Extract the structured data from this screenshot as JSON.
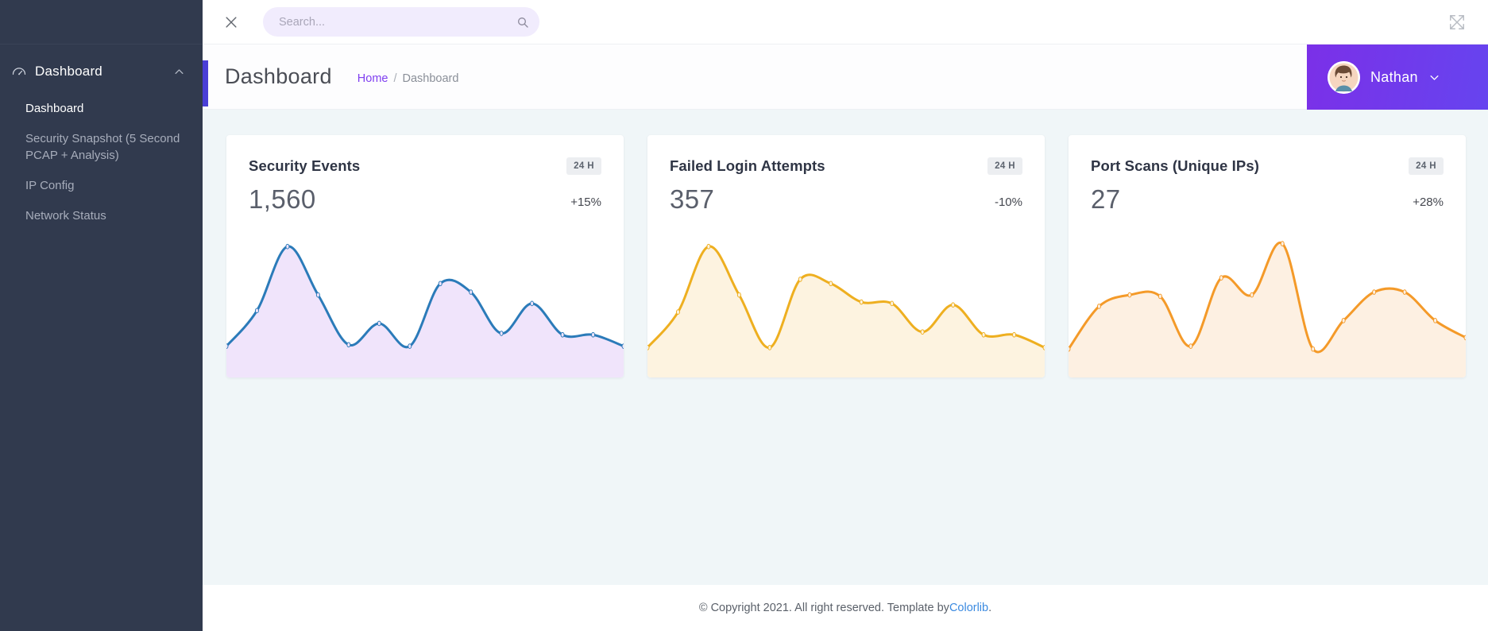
{
  "sidebar": {
    "group": {
      "label": "Dashboard",
      "icon": "speedometer-icon",
      "chevron": "chevron-up-icon"
    },
    "items": [
      {
        "label": "Dashboard",
        "active": true
      },
      {
        "label": "Security Snapshot (5 Second PCAP + Analysis)",
        "active": false
      },
      {
        "label": "IP Config",
        "active": false
      },
      {
        "label": "Network Status",
        "active": false
      }
    ]
  },
  "topbar": {
    "close_icon": "close-icon",
    "search": {
      "value": "",
      "placeholder": "Search...",
      "icon": "search-icon"
    },
    "fullscreen_icon": "fullscreen-expand-icon"
  },
  "header": {
    "title": "Dashboard",
    "breadcrumb": {
      "home": "Home",
      "separator": "/",
      "current": "Dashboard"
    },
    "profile": {
      "name": "Nathan",
      "caret_icon": "chevron-down-icon",
      "avatar_icon": "user-avatar"
    },
    "accent_color": "#4a3fd6",
    "profile_gradient_from": "#7b30e8",
    "profile_gradient_to": "#6644ef"
  },
  "cards": [
    {
      "title": "Security Events",
      "badge": "24 H",
      "value": "1,560",
      "delta": "+15%",
      "line_color": "#2b7bb9",
      "fill_color": "#f0e4fb"
    },
    {
      "title": "Failed Login Attempts",
      "badge": "24 H",
      "value": "357",
      "delta": "-10%",
      "line_color": "#eeaf20",
      "fill_color": "#fdf3e0"
    },
    {
      "title": "Port Scans (Unique IPs)",
      "badge": "24 H",
      "value": "27",
      "delta": "+28%",
      "line_color": "#f49a29",
      "fill_color": "#fdf0e2"
    }
  ],
  "chart_data": [
    {
      "type": "area",
      "title": "Security Events",
      "xlabel": "",
      "ylabel": "",
      "grid": false,
      "legend": "none",
      "line_color": "#2b7bb9",
      "fill_color": "#f0e4fb",
      "ylim": [
        0,
        100
      ],
      "x": [
        0,
        1,
        2,
        3,
        4,
        5,
        6,
        7,
        8,
        9,
        10,
        11,
        12,
        13
      ],
      "values": [
        22,
        47,
        92,
        58,
        23,
        38,
        22,
        66,
        60,
        31,
        52,
        30,
        30,
        22
      ]
    },
    {
      "type": "area",
      "title": "Failed Login Attempts",
      "xlabel": "",
      "ylabel": "",
      "grid": false,
      "legend": "none",
      "line_color": "#eeaf20",
      "fill_color": "#fdf3e0",
      "ylim": [
        0,
        100
      ],
      "x": [
        0,
        1,
        2,
        3,
        4,
        5,
        6,
        7,
        8,
        9,
        10,
        11,
        12,
        13
      ],
      "values": [
        21,
        46,
        92,
        58,
        21,
        69,
        66,
        53,
        52,
        32,
        51,
        30,
        30,
        21
      ]
    },
    {
      "type": "area",
      "title": "Port Scans (Unique IPs)",
      "xlabel": "",
      "ylabel": "",
      "grid": false,
      "legend": "none",
      "line_color": "#f49a29",
      "fill_color": "#fdf0e2",
      "ylim": [
        0,
        100
      ],
      "x": [
        0,
        1,
        2,
        3,
        4,
        5,
        6,
        7,
        8,
        9,
        10,
        11,
        12,
        13
      ],
      "values": [
        20,
        50,
        58,
        57,
        22,
        70,
        58,
        94,
        20,
        40,
        60,
        60,
        40,
        28
      ]
    }
  ],
  "footer": {
    "text": "© Copyright 2021. All right reserved. Template by ",
    "link": "Colorlib",
    "suffix": "."
  }
}
